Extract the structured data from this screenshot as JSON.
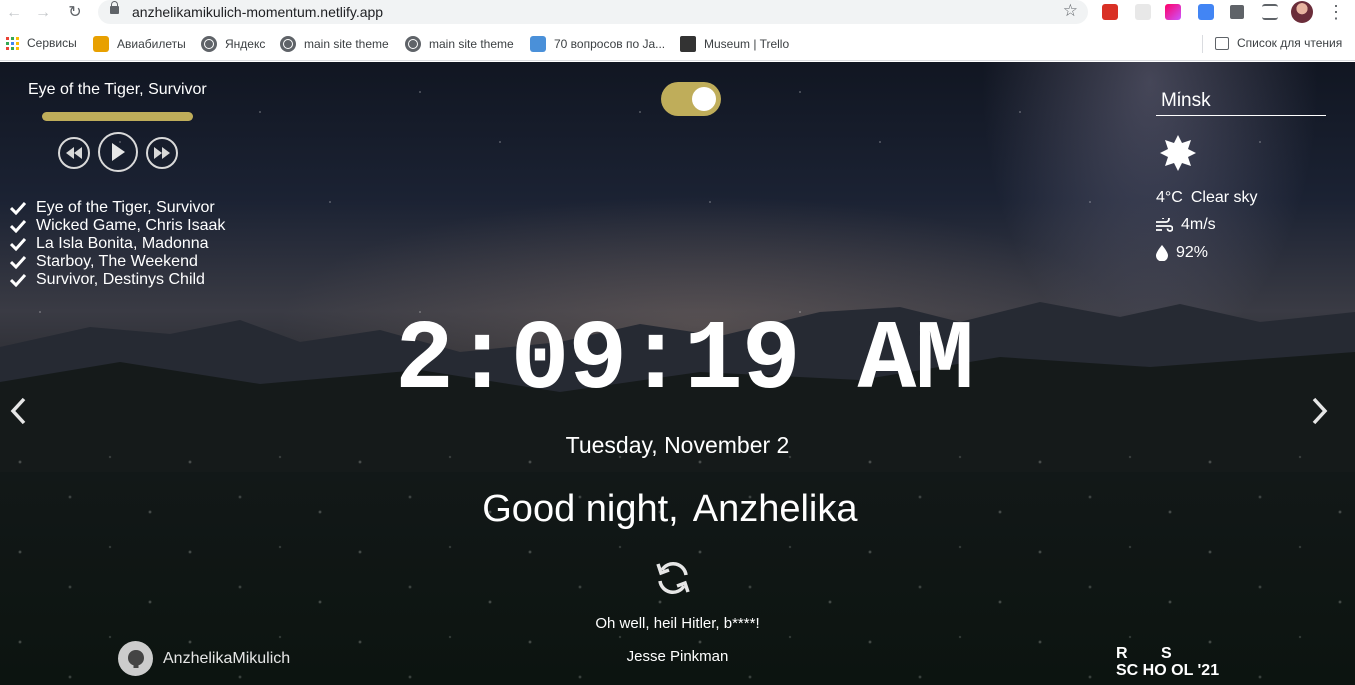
{
  "browser": {
    "url": "anzhelikamikulich-momentum.netlify.app",
    "bookmarks": [
      "Сервисы",
      "Авиабилеты",
      "Яндекс",
      "main site theme",
      "main site theme",
      "70 вопросов по Ja...",
      "Museum | Trello"
    ],
    "reading_list": "Список для чтения"
  },
  "player": {
    "current_title": "Eye of the Tiger, Survivor",
    "progress": 1.0,
    "playlist": [
      "Eye of the Tiger, Survivor",
      "Wicked Game, Chris Isaak",
      "La Isla Bonita, Madonna",
      "Starboy, The Weekend",
      "Survivor, Destinys Child"
    ]
  },
  "toggle": {
    "on": true
  },
  "weather": {
    "city": "Minsk",
    "icon": "sun-icon",
    "temp": "4°C",
    "description": "Clear sky",
    "wind": "4m/s",
    "humidity": "92%"
  },
  "time": "2:09:19 AM",
  "date": "Tuesday, November 2",
  "greeting": {
    "text": "Good night,",
    "name": "Anzhelika"
  },
  "quote": {
    "text": "Oh well, heil Hitler, b****!",
    "author": "Jesse Pinkman"
  },
  "footer": {
    "github_user": "AnzhelikaMikulich",
    "school_logo": "RS SCHOOL '21"
  },
  "colors": {
    "accent": "#bfad5a",
    "text": "#ffffff"
  }
}
